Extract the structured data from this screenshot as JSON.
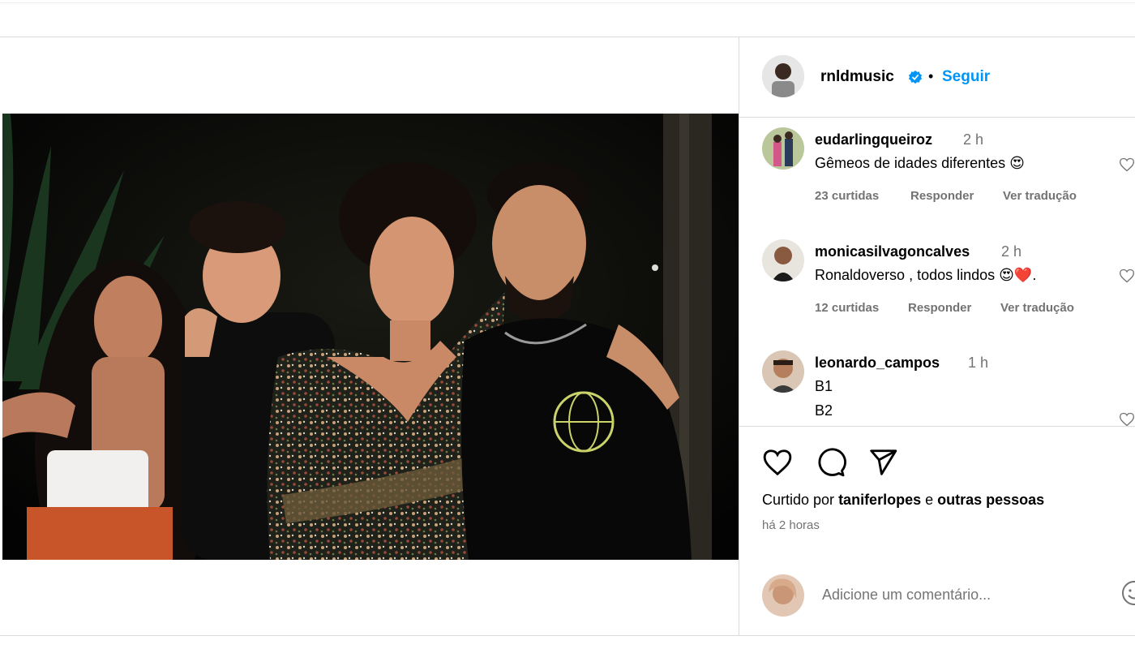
{
  "post": {
    "author": "rnldmusic",
    "follow_label": "Seguir",
    "separator": "•"
  },
  "comments": [
    {
      "user": "eudarlingqueiroz",
      "time": "2 h",
      "text": "Gêmeos de idades diferentes 😍",
      "likes": "23 curtidas",
      "reply": "Responder",
      "translate": "Ver tradução"
    },
    {
      "user": "monicasilvagoncalves",
      "time": "2 h",
      "text": "Ronaldoverso , todos lindos 😍❤️.",
      "likes": "12 curtidas",
      "reply": "Responder",
      "translate": "Ver tradução"
    },
    {
      "user": "leonardo_campos",
      "time": "1 h",
      "text_lines": [
        "B1",
        "B2"
      ]
    }
  ],
  "likes_line": {
    "prefix": "Curtido por",
    "user": "taniferlopes",
    "middle": "e",
    "suffix": "outras pessoas"
  },
  "posted_ago": "há 2 horas",
  "add_comment": {
    "placeholder": "Adicione um comentário..."
  },
  "icons": [
    "verified-badge-icon",
    "heart-icon",
    "comment-icon",
    "share-icon",
    "emoji-icon"
  ],
  "colors": {
    "accent": "#0095f6",
    "secondary_text": "#737373",
    "border": "#dbdbdb"
  }
}
